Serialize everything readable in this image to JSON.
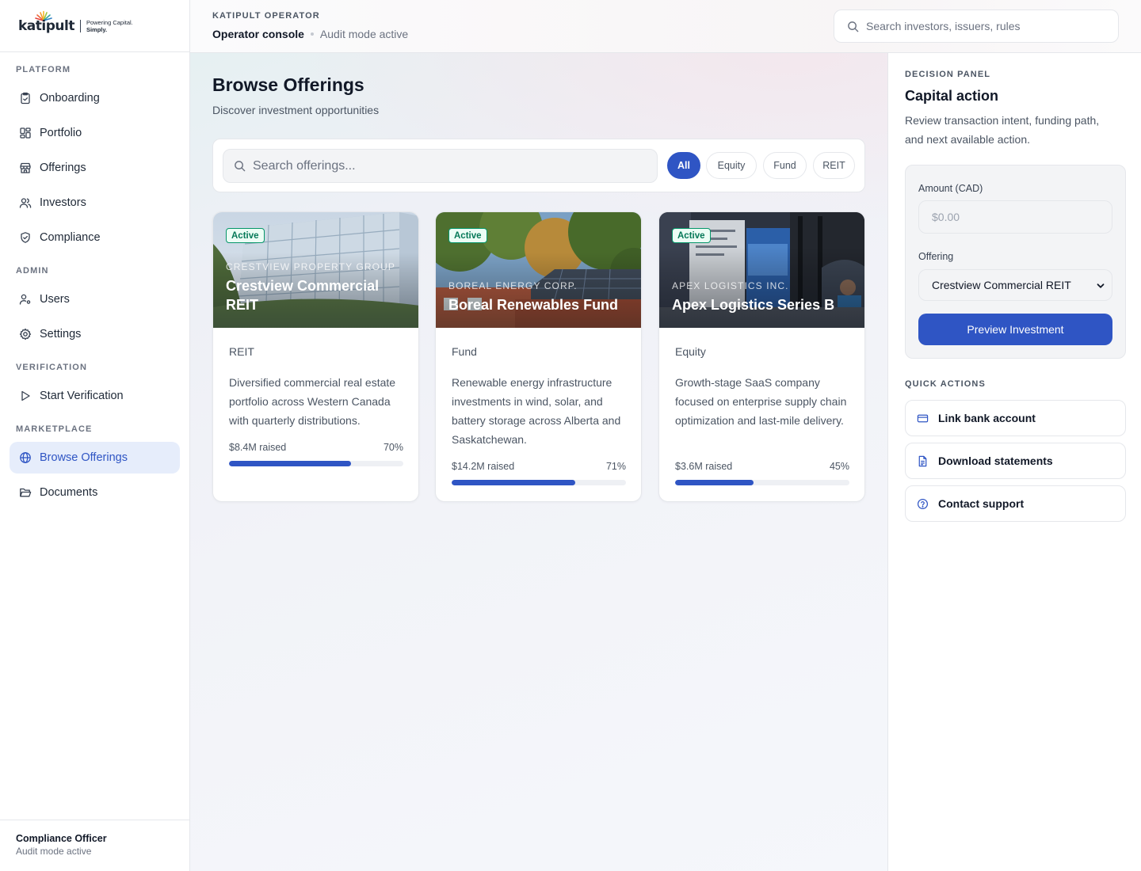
{
  "brand": {
    "logo_word": "katipult",
    "tagline_line1": "Powering Capital.",
    "tagline_line2": "Simply."
  },
  "sidebar": {
    "sections": [
      {
        "label": "PLATFORM",
        "items": [
          {
            "label": "Onboarding",
            "icon": "clipboard-check-icon"
          },
          {
            "label": "Portfolio",
            "icon": "dashboard-grid-icon"
          },
          {
            "label": "Offerings",
            "icon": "storefront-icon"
          },
          {
            "label": "Investors",
            "icon": "users-icon"
          },
          {
            "label": "Compliance",
            "icon": "shield-check-icon"
          }
        ]
      },
      {
        "label": "ADMIN",
        "items": [
          {
            "label": "Users",
            "icon": "user-cog-icon"
          },
          {
            "label": "Settings",
            "icon": "gear-icon"
          }
        ]
      },
      {
        "label": "VERIFICATION",
        "items": [
          {
            "label": "Start Verification",
            "icon": "play-icon"
          }
        ]
      },
      {
        "label": "MARKETPLACE",
        "items": [
          {
            "label": "Browse Offerings",
            "icon": "globe-icon",
            "active": true
          },
          {
            "label": "Documents",
            "icon": "folder-open-icon"
          }
        ]
      }
    ],
    "footer": {
      "name": "Compliance Officer",
      "status": "Audit mode active"
    }
  },
  "topbar": {
    "kicker": "KATIPULT OPERATOR",
    "title": "Operator console",
    "status": "Audit mode active",
    "search_placeholder": "Search investors, issuers, rules"
  },
  "main": {
    "title": "Browse Offerings",
    "subtitle": "Discover investment opportunities",
    "search_placeholder": "Search offerings...",
    "filters": [
      {
        "label": "All",
        "active": true
      },
      {
        "label": "Equity",
        "active": false
      },
      {
        "label": "Fund",
        "active": false
      },
      {
        "label": "REIT",
        "active": false
      }
    ],
    "offerings": [
      {
        "status": "Active",
        "issuer": "Crestview Property Group",
        "name": "Crestview Commercial REIT",
        "type": "REIT",
        "description": "Diversified commercial real estate portfolio across Western Canada with quarterly distributions.",
        "raised": "$8.4M raised",
        "percent_label": "70%",
        "progress": 0.7
      },
      {
        "status": "Active",
        "issuer": "Boreal Energy Corp.",
        "name": "Boreal Renewables Fund",
        "type": "Fund",
        "description": "Renewable energy infrastructure investments in wind, solar, and battery storage across Alberta and Saskatchewan.",
        "raised": "$14.2M raised",
        "percent_label": "71%",
        "progress": 0.71
      },
      {
        "status": "Active",
        "issuer": "Apex Logistics Inc.",
        "name": "Apex Logistics Series B",
        "type": "Equity",
        "description": "Growth-stage SaaS company focused on enterprise supply chain optimization and last-mile delivery.",
        "raised": "$3.6M raised",
        "percent_label": "45%",
        "progress": 0.45
      }
    ]
  },
  "panel": {
    "kicker": "DECISION PANEL",
    "title": "Capital action",
    "description": "Review transaction intent, funding path, and next available action.",
    "amount_label": "Amount (CAD)",
    "amount_placeholder": "$0.00",
    "offering_label": "Offering",
    "offering_selected": "Crestview Commercial REIT",
    "preview_button": "Preview Investment",
    "quick_actions_label": "QUICK ACTIONS",
    "quick_actions": [
      {
        "label": "Link bank account",
        "icon": "credit-card-icon"
      },
      {
        "label": "Download statements",
        "icon": "document-icon"
      },
      {
        "label": "Contact support",
        "icon": "help-circle-icon"
      }
    ]
  },
  "colors": {
    "accent": "#2f55c4",
    "active_nav_bg": "#e6edfb",
    "badge_green": "#047857"
  }
}
